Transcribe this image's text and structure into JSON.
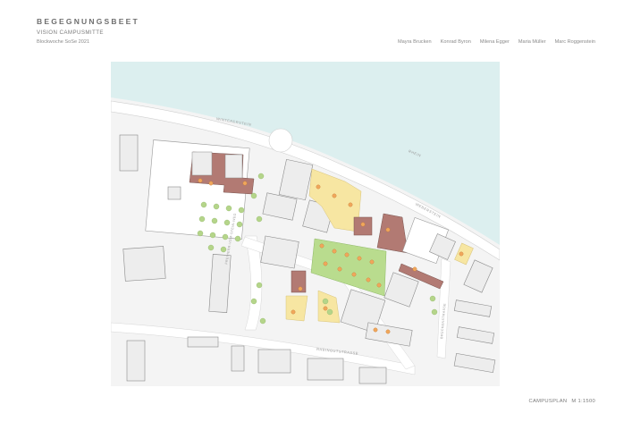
{
  "header": {
    "title": "BEGEGNUNGSBEET",
    "subtitle": "VISION CAMPUSMITTE",
    "course": "Blockwoche SoSe 2021"
  },
  "authors": [
    "Mayra Brucken",
    "Konrad Byron",
    "Milena Egger",
    "Maria Müller",
    "Marc Roggenstein"
  ],
  "plan": {
    "streets": {
      "top": "WINTERERSTEIN",
      "right": "WEBERSTEIN",
      "left_vertical": "FREIHERR-VOM-STEIN-WEG",
      "bottom": "RHEINGUTSTRASSE",
      "right_lower": "BRÜCKENSTRASSE",
      "river": "RHEIN"
    },
    "caption": "CAMPUSPLAN",
    "scale": "M 1:1500"
  },
  "colors": {
    "water": "#dcefef",
    "ground": "#f4f4f4",
    "road": "#ffffff",
    "building": "#ededed",
    "building_stroke": "#8a8a8a",
    "red_building": "#b27a73",
    "yellow_area": "#f7e6a2",
    "green_area": "#b9dc8e",
    "tree_green": "#b5d58a",
    "tree_orange": "#f0a75b"
  }
}
